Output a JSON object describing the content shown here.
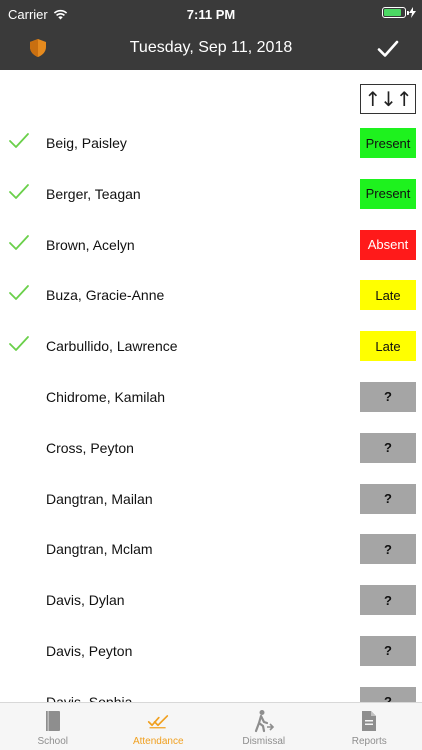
{
  "status_bar": {
    "carrier": "Carrier",
    "time": "7:11 PM",
    "battery_level": 0.85
  },
  "nav": {
    "title": "Tuesday, Sep 11, 2018"
  },
  "sort_button": {
    "label": "↑↓↑"
  },
  "students": [
    {
      "name": "Beig, Paisley",
      "status": "Present",
      "kind": "present",
      "checked": true
    },
    {
      "name": "Berger, Teagan",
      "status": "Present",
      "kind": "present",
      "checked": true
    },
    {
      "name": "Brown, Acelyn",
      "status": "Absent",
      "kind": "absent",
      "checked": true
    },
    {
      "name": "Buza, Gracie-Anne",
      "status": "Late",
      "kind": "late",
      "checked": true
    },
    {
      "name": "Carbullido, Lawrence",
      "status": "Late",
      "kind": "late",
      "checked": true
    },
    {
      "name": "Chidrome, Kamilah",
      "status": "?",
      "kind": "unknown",
      "checked": false
    },
    {
      "name": "Cross, Peyton",
      "status": "?",
      "kind": "unknown",
      "checked": false
    },
    {
      "name": "Dangtran, Mailan",
      "status": "?",
      "kind": "unknown",
      "checked": false
    },
    {
      "name": "Dangtran, Mclam",
      "status": "?",
      "kind": "unknown",
      "checked": false
    },
    {
      "name": "Davis, Dylan",
      "status": "?",
      "kind": "unknown",
      "checked": false
    },
    {
      "name": "Davis, Peyton",
      "status": "?",
      "kind": "unknown",
      "checked": false
    },
    {
      "name": "Davis, Sophia",
      "status": "?",
      "kind": "unknown",
      "checked": false
    }
  ],
  "tabs": [
    {
      "label": "School",
      "icon": "book-icon",
      "active": false
    },
    {
      "label": "Attendance",
      "icon": "double-check-icon",
      "active": true
    },
    {
      "label": "Dismissal",
      "icon": "person-walking-icon",
      "active": false
    },
    {
      "label": "Reports",
      "icon": "document-icon",
      "active": false
    }
  ],
  "colors": {
    "bar_bg": "#3a3a3a",
    "present": "#1ef21e",
    "absent": "#ff1a1a",
    "late": "#ffff00",
    "unknown": "#a5a5a5",
    "check": "#6ad04a",
    "accent": "#f0a020",
    "shield": "#e58a1e"
  }
}
